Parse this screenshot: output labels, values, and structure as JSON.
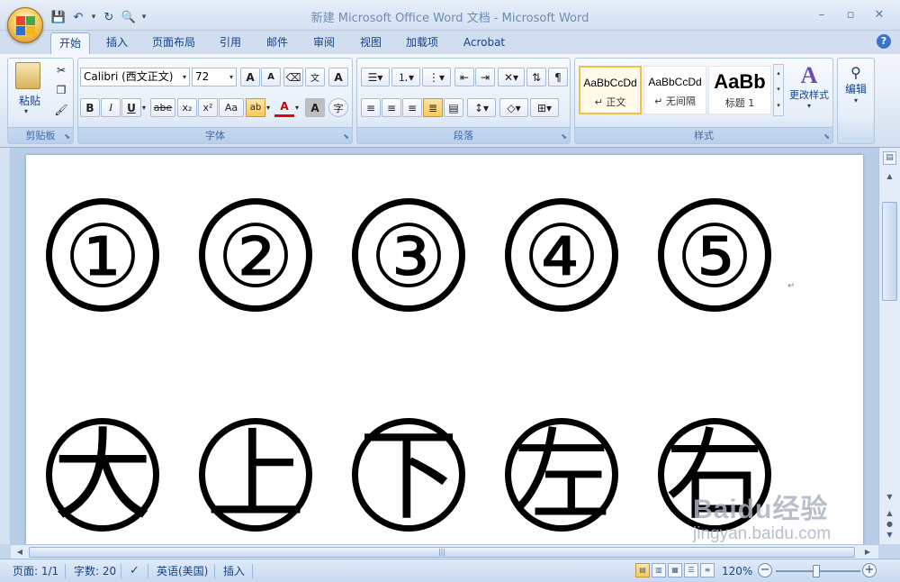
{
  "window": {
    "title": "新建 Microsoft Office Word 文档 - Microsoft Word",
    "minimize": "–",
    "maximize": "▫",
    "close": "✕"
  },
  "tabs": [
    {
      "label": "开始",
      "active": true
    },
    {
      "label": "插入"
    },
    {
      "label": "页面布局"
    },
    {
      "label": "引用"
    },
    {
      "label": "邮件"
    },
    {
      "label": "审阅"
    },
    {
      "label": "视图"
    },
    {
      "label": "加载项"
    },
    {
      "label": "Acrobat"
    }
  ],
  "help_label": "?",
  "ribbon": {
    "clipboard": {
      "label": "剪贴板",
      "paste_label": "粘贴"
    },
    "font": {
      "label": "字体",
      "font_name": "Calibri (西文正文)",
      "font_size": "72",
      "bold": "B",
      "italic": "I",
      "underline": "U",
      "strike": "abe",
      "subscript": "x₂",
      "superscript": "x²",
      "change_case": "Aa",
      "grow": "A",
      "shrink": "A",
      "char_border": "A",
      "char_shade": "A",
      "enclose": "字"
    },
    "paragraph": {
      "label": "段落"
    },
    "styles": {
      "label": "样式",
      "items": [
        {
          "sample": "AaBbCcDd",
          "name": "↵ 正文",
          "active": true
        },
        {
          "sample": "AaBbCcDd",
          "name": "↵ 无间隔"
        },
        {
          "sample": "AaBb",
          "name": "标题 1"
        }
      ],
      "change_styles_label": "更改样式"
    },
    "editing": {
      "label": "编辑"
    }
  },
  "document": {
    "row1": [
      "①",
      "②",
      "③",
      "④",
      "⑤"
    ],
    "row2": [
      "大",
      "上",
      "下",
      "左",
      "右"
    ],
    "para_mark": "↵"
  },
  "status": {
    "page": "页面: 1/1",
    "words": "字数: 20",
    "language": "英语(美国)",
    "mode": "插入",
    "zoom": "120%",
    "zoom_minus": "−",
    "zoom_plus": "+"
  },
  "watermark": {
    "brand": "Baidu经验",
    "url": "jingyan.baidu.com"
  }
}
